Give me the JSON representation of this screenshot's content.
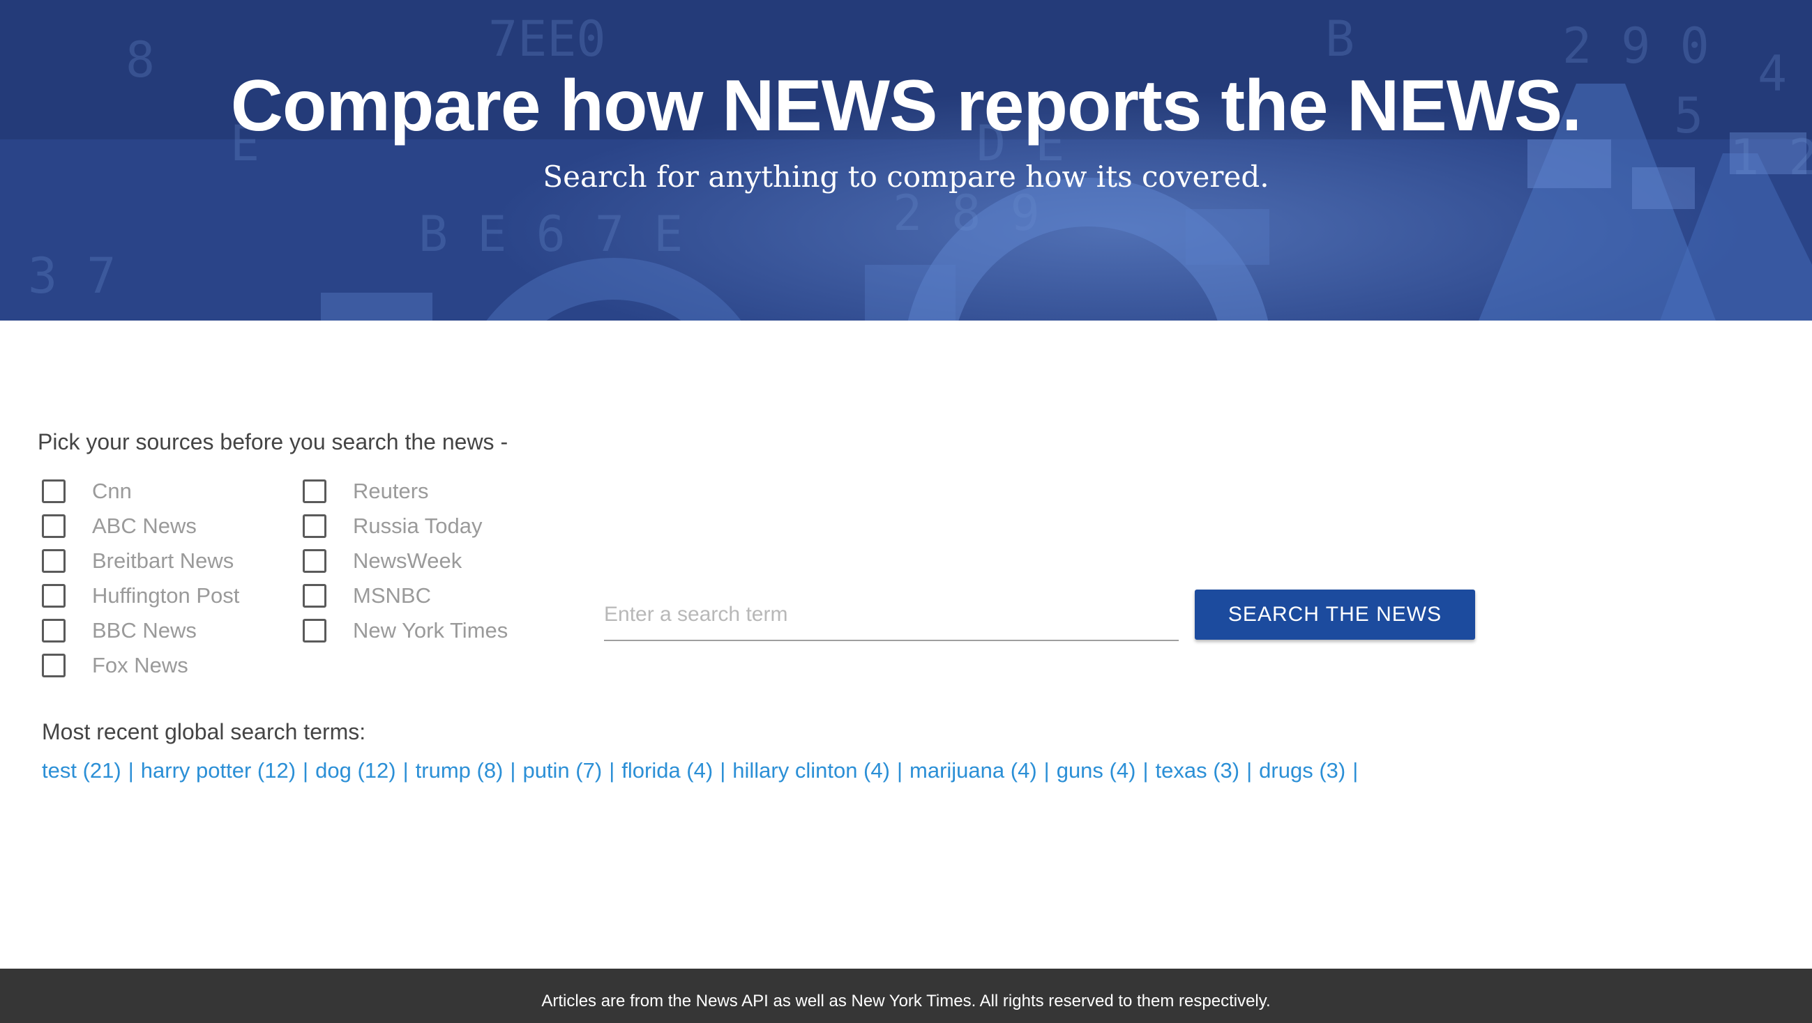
{
  "hero": {
    "title": "Compare how NEWS reports the NEWS.",
    "subtitle": "Search for anything to compare how its covered."
  },
  "sources": {
    "label": "Pick your sources before you search the news -",
    "column1": [
      {
        "label": "Cnn",
        "checked": false
      },
      {
        "label": "ABC News",
        "checked": false
      },
      {
        "label": "Breitbart News",
        "checked": false
      },
      {
        "label": "Huffington Post",
        "checked": false
      },
      {
        "label": "BBC News",
        "checked": false
      },
      {
        "label": "Fox News",
        "checked": false
      }
    ],
    "column2": [
      {
        "label": "Reuters",
        "checked": false
      },
      {
        "label": "Russia Today",
        "checked": false
      },
      {
        "label": "NewsWeek",
        "checked": false
      },
      {
        "label": "MSNBC",
        "checked": false
      },
      {
        "label": "New York Times",
        "checked": false
      }
    ]
  },
  "search": {
    "placeholder": "Enter a search term",
    "value": "",
    "button_label": "SEARCH THE NEWS"
  },
  "recent": {
    "label": "Most recent global search terms:",
    "terms": [
      "test (21)",
      "harry potter (12)",
      "dog (12)",
      "trump (8)",
      "putin (7)",
      "florida (4)",
      "hillary clinton (4)",
      "marijuana (4)",
      "guns (4)",
      "texas (3)",
      "drugs (3)"
    ],
    "separator": "|"
  },
  "footer": {
    "text": "Articles are from the News API as well as New York Times. All rights reserved to them respectively."
  },
  "colors": {
    "hero_background": "#2a4890",
    "button_background": "#1c4b9e",
    "link": "#2b8fd6",
    "footer_background": "#363636"
  }
}
